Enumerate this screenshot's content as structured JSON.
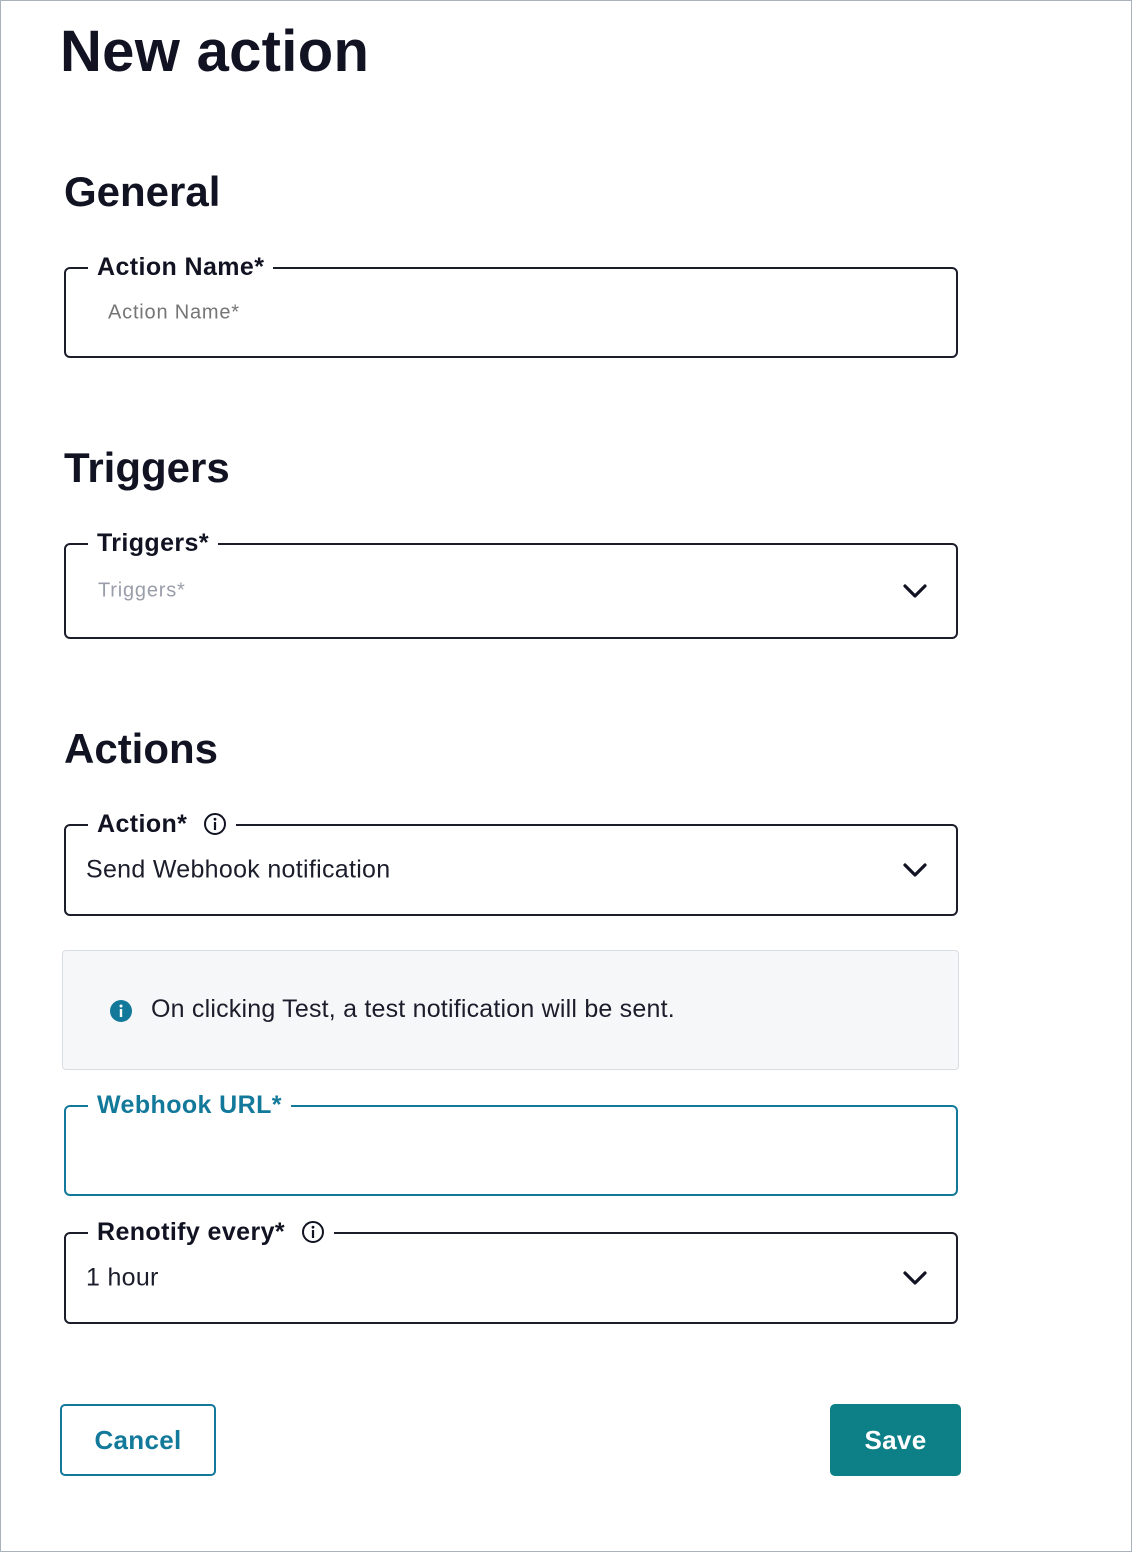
{
  "page": {
    "title": "New action"
  },
  "general": {
    "heading": "General",
    "action_name": {
      "label": "Action Name*",
      "placeholder": "Action Name*",
      "value": ""
    }
  },
  "triggers": {
    "heading": "Triggers",
    "triggers_select": {
      "label": "Triggers*",
      "placeholder": "Triggers*"
    }
  },
  "actions": {
    "heading": "Actions",
    "action_select": {
      "label": "Action*",
      "value": "Send Webhook notification",
      "info_icon": "info-outline-icon"
    },
    "callout": {
      "text": "On clicking Test, a test notification will be sent.",
      "icon": "info-filled-icon",
      "icon_color": "#13799a"
    },
    "webhook_url": {
      "label": "Webhook URL*",
      "value": ""
    },
    "renotify": {
      "label": "Renotify every*",
      "value": "1 hour",
      "info_icon": "info-outline-icon"
    }
  },
  "buttons": {
    "cancel": "Cancel",
    "save": "Save"
  },
  "colors": {
    "accent": "#13799a",
    "primary_button": "#0d7f86",
    "text": "#111322"
  }
}
